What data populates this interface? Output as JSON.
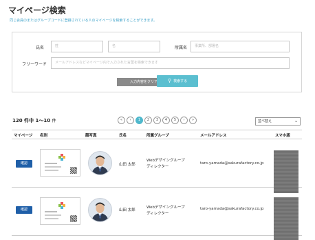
{
  "page": {
    "title": "マイページ検索",
    "description": "同じ会員のまたはグループコードに登録されている人のマイページを検索することができます。"
  },
  "search": {
    "name_label": "氏名",
    "last_name_placeholder": "姓",
    "first_name_placeholder": "名",
    "company_label": "所属名",
    "company_placeholder": "事業所、部署名",
    "freeword_label": "フリーワード",
    "freeword_placeholder": "メールアドレスなどマイページ内で入力された言葉を検索できます",
    "clear_label": "入力内容をクリア",
    "search_label": "検索する",
    "search_icon": "search-icon"
  },
  "results": {
    "count_main": "120 件中 1～10",
    "count_suffix": "件",
    "pages": [
      "«",
      "‹",
      "1",
      "2",
      "3",
      "4",
      "5",
      "›",
      "»"
    ],
    "active_page": "1",
    "sort_label": "並べ替え",
    "sort_icon": "chevron-down-icon"
  },
  "table": {
    "headers": [
      "マイページ",
      "名刺",
      "顔写真",
      "氏名",
      "所属グループ",
      "メールアドレス",
      "スマホ版"
    ],
    "rows": [
      {
        "button_label": "確認",
        "name": "山田 太郎",
        "group": "Webデザイングループ ディレクター",
        "group_line1": "Webデザイングループ",
        "group_line2": "ディレクター",
        "email": "taro-yamada@sakurafactory.co.jp"
      },
      {
        "button_label": "確認",
        "name": "山田 太郎",
        "group": "Webデザイングループ ディレクター",
        "group_line1": "Webデザイングループ",
        "group_line2": "ディレクター",
        "email": "taro-yamada@sakurafactory.co.jp"
      }
    ]
  },
  "colors": {
    "accent": "#5bbfd0",
    "primary_button": "#1f5fa8",
    "clear_button": "#8a8a8a",
    "description_text": "#3aa0c8"
  }
}
